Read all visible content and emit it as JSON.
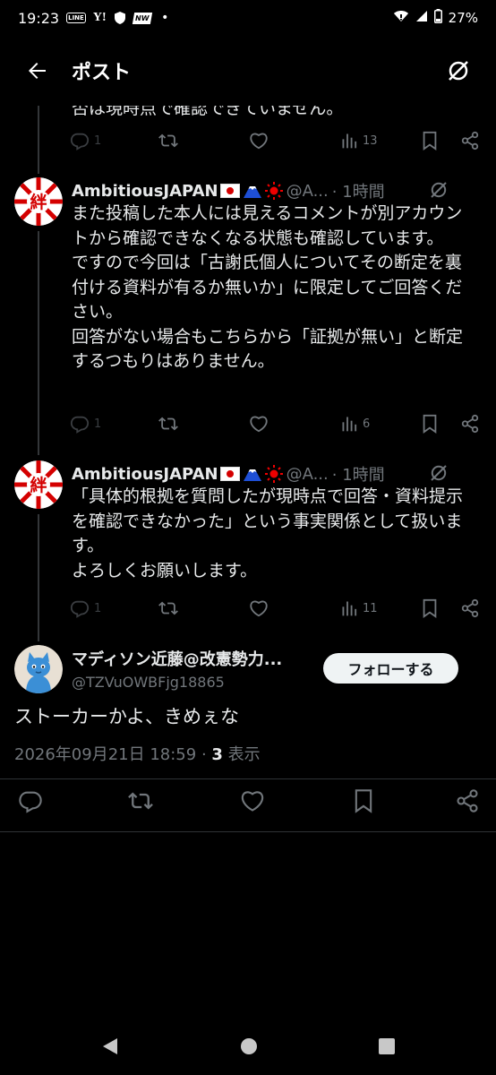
{
  "status_bar": {
    "time": "19:23",
    "notif_line": "LINE",
    "notif_yahoo": "Y!",
    "notif_news": "NW",
    "notif_dot": "•",
    "battery": "27%"
  },
  "header": {
    "title": "ポスト"
  },
  "prev_tweet": {
    "cut_text": "否は現時点で確認できていません。",
    "replies": "1",
    "views": "13"
  },
  "tweets": [
    {
      "author": "AmbitiousJAPAN",
      "handle": "@A...",
      "time": "· 1時間",
      "body": "また投稿した本人には見えるコメントが別アカウントから確認できなくなる状態も確認しています。\nですので今回は「古謝氏個人についてその断定を裏付ける資料が有るか無いか」に限定してご回答ください。\n回答がない場合もこちらから「証拠が無い」と断定するつもりはありません。",
      "replies": "1",
      "views": "6"
    },
    {
      "author": "AmbitiousJAPAN",
      "handle": "@A...",
      "time": "· 1時間",
      "body": "「具体的根拠を質問したが現時点で回答・資料提示を確認できなかった」という事実関係として扱います。\nよろしくお願いします。",
      "replies": "1",
      "views": "11"
    }
  ],
  "main_tweet": {
    "author": "マディソン近藤@改憲勢力...",
    "handle": "@TZVuOWBFjg18865",
    "follow_label": "フォローする",
    "text": "ストーカーかよ、きめぇな",
    "timestamp": "2026年09月21日 18:59",
    "separator": " · ",
    "views_count": "3",
    "views_label": " 表示"
  },
  "avatar_kanji": "絆"
}
